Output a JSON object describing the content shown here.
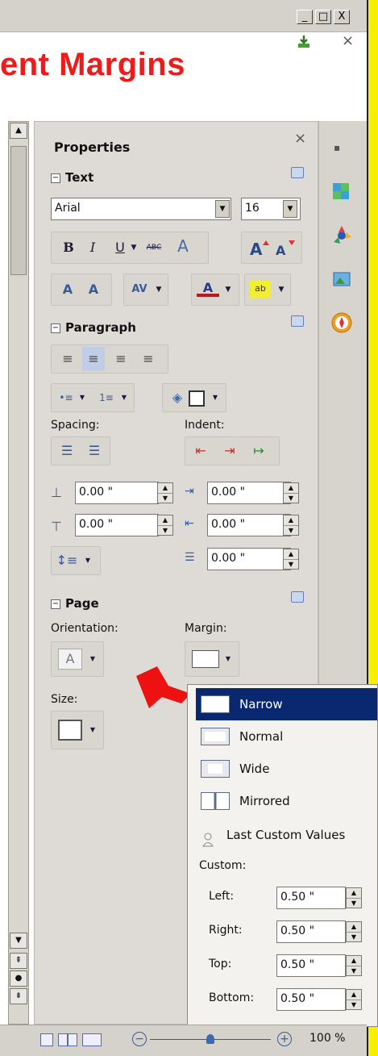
{
  "window": {
    "minimize": "_",
    "maximize": "□",
    "close": "X"
  },
  "slide_title": "ent Margins",
  "panel": {
    "title": "Properties",
    "close": "×"
  },
  "text_section": {
    "title": "Text",
    "font_name": "Arial",
    "font_size": "16",
    "bold": "B",
    "italic": "I",
    "underline": "U",
    "strike": "ABC",
    "shadow": "A"
  },
  "paragraph_section": {
    "title": "Paragraph",
    "spacing_label": "Spacing:",
    "indent_label": "Indent:",
    "above": "0.00 \"",
    "below": "0.00 \"",
    "before_text": "0.00 \"",
    "after_text": "0.00 \"",
    "first_line": "0.00 \""
  },
  "page_section": {
    "title": "Page",
    "orientation_label": "Orientation:",
    "orientation_glyph": "A",
    "margin_label": "Margin:",
    "size_label": "Size:"
  },
  "margin_menu": {
    "options": [
      "Narrow",
      "Normal",
      "Wide",
      "Mirrored"
    ],
    "selected": "Narrow",
    "last_custom": "Last Custom Values",
    "custom_label": "Custom:",
    "left_label": "Left:",
    "left_value": "0.50 \"",
    "right_label": "Right:",
    "right_value": "0.50 \"",
    "top_label": "Top:",
    "top_value": "0.50 \"",
    "bottom_label": "Bottom:",
    "bottom_value": "0.50 \""
  },
  "status": {
    "zoom": "100 %",
    "zoom_minus": "−",
    "zoom_plus": "+"
  },
  "colors": {
    "accent_red": "#ee1b1b",
    "selection": "#0a2870",
    "yellow": "#f6f000"
  }
}
